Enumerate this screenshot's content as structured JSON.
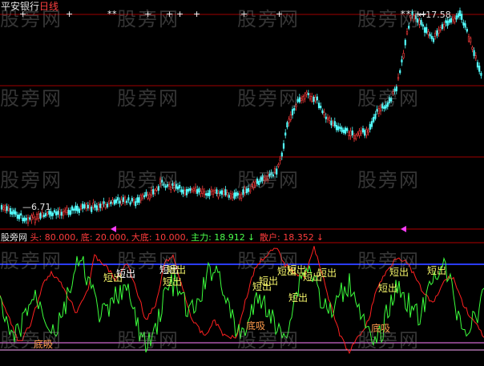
{
  "header": {
    "stock_name": "平安银行",
    "period": "日线",
    "high_label": "17.58",
    "low_label": "6.71"
  },
  "indicator": {
    "name": "股旁网",
    "params": [
      {
        "label": "头",
        "value": "80.000",
        "color": "#ff3c3c"
      },
      {
        "label": "底",
        "value": "20.000",
        "color": "#ff3c3c"
      },
      {
        "label": "大底",
        "value": "10.000",
        "color": "#ff3c3c"
      },
      {
        "label": "主力",
        "value": "18.912",
        "arrow": "↓",
        "color": "#4cff4c"
      },
      {
        "label": "散户",
        "value": "18.352",
        "arrow": "↓",
        "color": "#ff3c3c"
      }
    ]
  },
  "watermarks": [
    "股旁网",
    "股旁网",
    "股旁网",
    "股旁网",
    "股旁网",
    "股旁网",
    "股旁网",
    "股旁网",
    "股旁网",
    "股旁网",
    "股旁网",
    "股旁网",
    "股旁网",
    "股旁网",
    "股旁网",
    "股旁网",
    "股旁网",
    "股旁网",
    "股旁网",
    "股旁网"
  ],
  "signals": [
    {
      "text": "短出",
      "color": "#f5f56a"
    },
    {
      "text": "短出",
      "color": "#ffffff"
    },
    {
      "text": "短出",
      "color": "#ffffff"
    },
    {
      "text": "短出",
      "color": "#f5f56a"
    },
    {
      "text": "短出",
      "color": "#f5f56a"
    },
    {
      "text": "短出",
      "color": "#f5f56a"
    },
    {
      "text": "短出",
      "color": "#f5f56a"
    },
    {
      "text": "短出",
      "color": "#f5f56a"
    },
    {
      "text": "短出",
      "color": "#f5f56a"
    },
    {
      "text": "短出",
      "color": "#f5f56a"
    },
    {
      "text": "短出",
      "color": "#f5f56a"
    },
    {
      "text": "短出",
      "color": "#f5f56a"
    },
    {
      "text": "短出",
      "color": "#f5f56a"
    },
    {
      "text": "短出",
      "color": "#f5f56a"
    },
    {
      "text": "短出",
      "color": "#f5f56a"
    },
    {
      "text": "底吸",
      "color": "#ff9a4c"
    },
    {
      "text": "底吸",
      "color": "#ff9a4c"
    },
    {
      "text": "底吸",
      "color": "#ff9a4c"
    }
  ]
}
